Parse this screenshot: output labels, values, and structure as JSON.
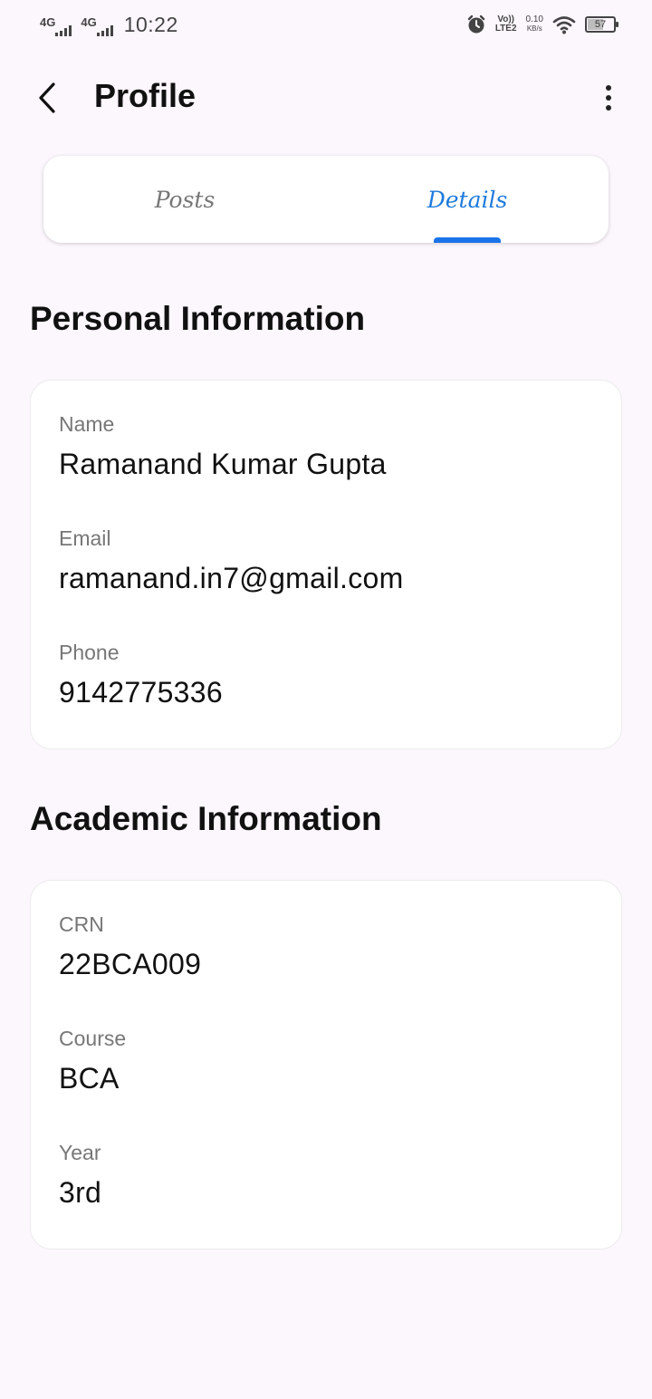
{
  "status_bar": {
    "network1": "4G",
    "network2": "4G",
    "time": "10:22",
    "volte_top": "Vo))",
    "volte_bottom": "LTE2",
    "speed_value": "0.10",
    "speed_unit": "KB/s",
    "battery": "57",
    "battery_level": 0.57,
    "icons": [
      "signal-icon",
      "alarm-icon",
      "wifi-icon",
      "battery-icon"
    ]
  },
  "app_bar": {
    "title": "Profile",
    "back_icon": "chevron-left-icon",
    "menu_icon": "more-vert-icon"
  },
  "tabs": [
    {
      "label": "Posts",
      "selected": false
    },
    {
      "label": "Details",
      "selected": true
    }
  ],
  "colors": {
    "accent": "#1a73e8",
    "background": "#fcf6fd"
  },
  "personal": {
    "title": "Personal Information",
    "fields": [
      {
        "label": "Name",
        "value": "Ramanand Kumar Gupta"
      },
      {
        "label": "Email",
        "value": "ramanand.in7@gmail.com"
      },
      {
        "label": "Phone",
        "value": "9142775336"
      }
    ]
  },
  "academic": {
    "title": "Academic Information",
    "fields": [
      {
        "label": "CRN",
        "value": "22BCA009"
      },
      {
        "label": "Course",
        "value": "BCA"
      },
      {
        "label": "Year",
        "value": "3rd"
      }
    ]
  }
}
